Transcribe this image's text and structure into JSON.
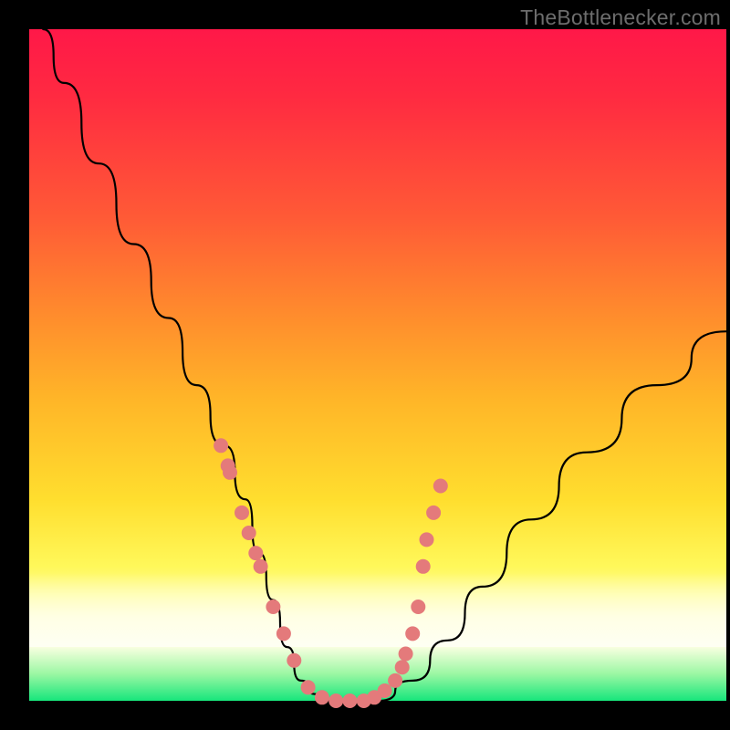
{
  "watermark": "TheBottlenecker.com",
  "chart_data": {
    "type": "line",
    "title": "",
    "xlabel": "",
    "ylabel": "",
    "xlim": [
      0,
      100
    ],
    "ylim": [
      0,
      100
    ],
    "series": [
      {
        "name": "bottleneck-curve",
        "x": [
          2,
          5,
          10,
          15,
          20,
          24,
          28,
          31,
          33,
          35,
          37,
          39,
          41,
          43,
          46,
          50,
          55,
          60,
          65,
          72,
          80,
          90,
          100
        ],
        "y": [
          100,
          92,
          80,
          68,
          57,
          47,
          38,
          30,
          22,
          15,
          8,
          3,
          1,
          0,
          0,
          0,
          3,
          9,
          17,
          27,
          37,
          47,
          55
        ]
      }
    ],
    "markers": {
      "name": "highlighted-points",
      "x": [
        27.5,
        28.5,
        28.8,
        30.5,
        31.5,
        32.5,
        33.2,
        35.0,
        36.5,
        38.0,
        40.0,
        42.0,
        44.0,
        46.0,
        48.0,
        49.5,
        51.0,
        52.5,
        53.5,
        54.0,
        55.0,
        55.8,
        56.5,
        57.0,
        58.0,
        59.0
      ],
      "y": [
        38,
        35,
        34,
        28,
        25,
        22,
        20,
        14,
        10,
        6,
        2,
        0.5,
        0,
        0,
        0,
        0.5,
        1.5,
        3,
        5,
        7,
        10,
        14,
        20,
        24,
        28,
        32
      ]
    },
    "gradient_stops": [
      {
        "pos": 0,
        "color": "#ff1848"
      },
      {
        "pos": 28,
        "color": "#ff5a36"
      },
      {
        "pos": 55,
        "color": "#ffb528"
      },
      {
        "pos": 80,
        "color": "#fff85a"
      },
      {
        "pos": 92,
        "color": "#f8ffe0"
      },
      {
        "pos": 100,
        "color": "#17e67c"
      }
    ]
  }
}
